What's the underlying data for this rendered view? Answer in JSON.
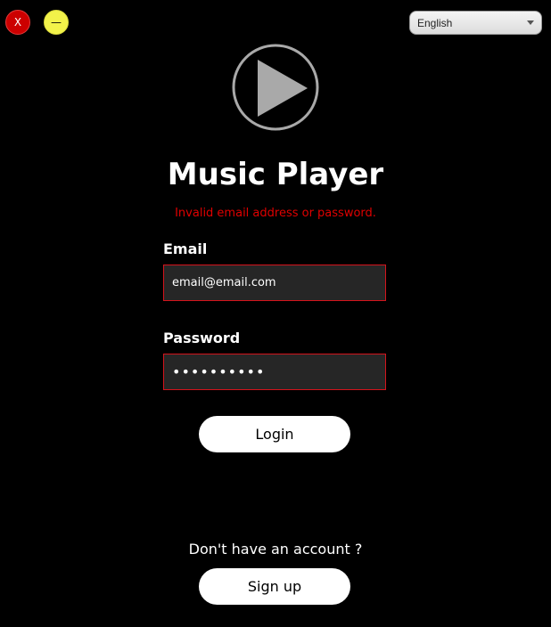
{
  "window": {
    "close_label": "X",
    "minimize_label": "—"
  },
  "language": {
    "selected": "English"
  },
  "app": {
    "title": "Music Player"
  },
  "login": {
    "error_message": "Invalid email address or password.",
    "email_label": "Email",
    "email_value": "email@email.com",
    "password_label": "Password",
    "password_value": "••••••••••",
    "login_button": "Login"
  },
  "signup": {
    "prompt": "Don't have an account ?",
    "button": "Sign up"
  },
  "colors": {
    "background": "#000000",
    "error": "#e00000",
    "input_border": "#d4141c",
    "close_button": "#cc0000",
    "minimize_button": "#f2f24a",
    "logo": "#a9a9a9"
  },
  "icons": {
    "logo": "play-icon",
    "select": "caret-down-icon"
  }
}
